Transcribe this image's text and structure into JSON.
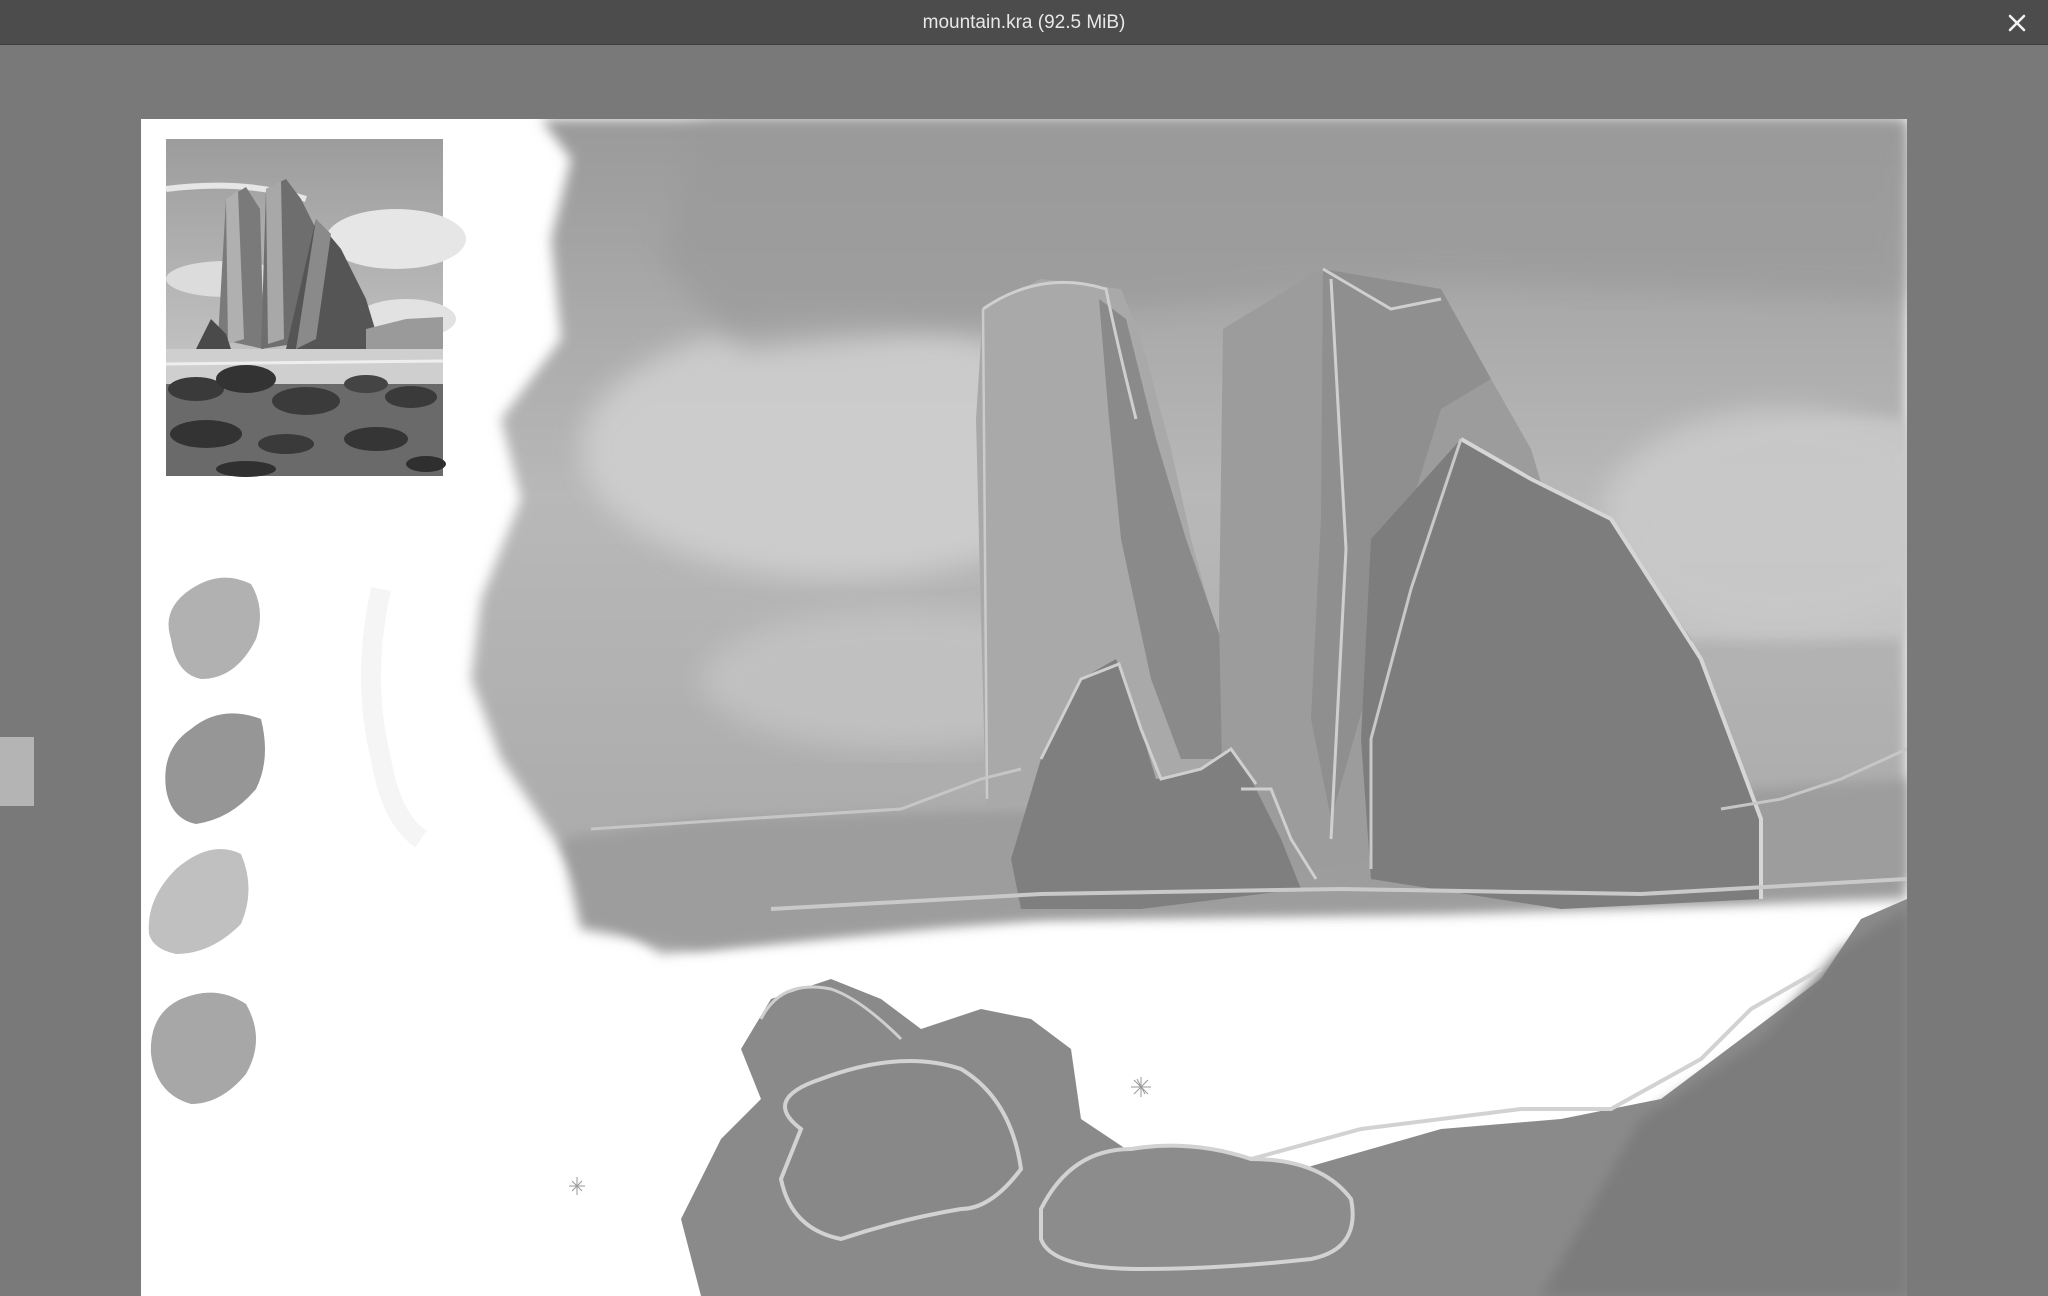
{
  "window": {
    "title": "mountain.kra (92.5 MiB)",
    "close_icon": "close-icon"
  },
  "viewer": {
    "background_color": "#797979",
    "side_handle_icon": "drawer-handle"
  },
  "document": {
    "file_name": "mountain.kra",
    "file_size": "92.5 MiB",
    "content": "grayscale painting of rock spires on a beach with reference thumbnail and swatches"
  }
}
